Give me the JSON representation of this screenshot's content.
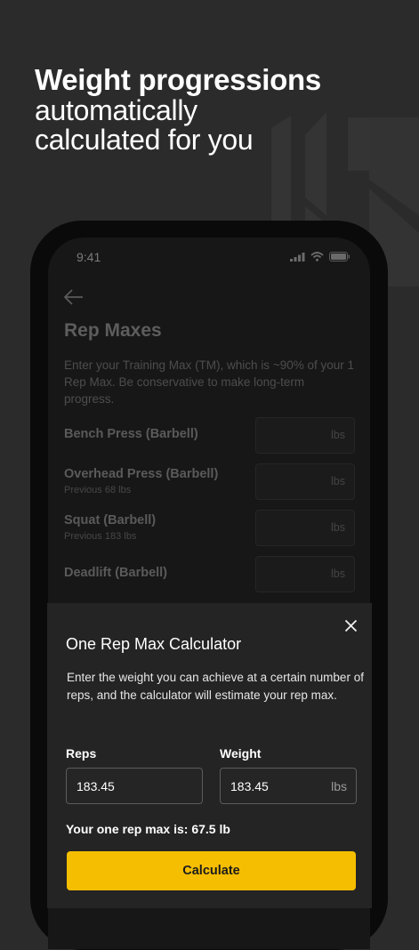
{
  "headline": {
    "bold": "Weight progressions",
    "line2": "automatically",
    "line3": "calculated for you"
  },
  "status_bar": {
    "time": "9:41",
    "icons": [
      "signal-icon",
      "wifi-icon",
      "battery-icon"
    ]
  },
  "screen": {
    "title": "Rep Maxes",
    "description": "Enter your Training Max (TM), which is ~90% of your 1 Rep Max. Be conservative to make long-term progress.",
    "exercises": [
      {
        "name": "Bench Press (Barbell)",
        "previous": "",
        "unit": "lbs"
      },
      {
        "name": "Overhead Press (Barbell)",
        "previous": "Previous 68 lbs",
        "unit": "lbs"
      },
      {
        "name": "Squat (Barbell)",
        "previous": "Previous 183 lbs",
        "unit": "lbs"
      },
      {
        "name": "Deadlift (Barbell)",
        "previous": "",
        "unit": "lbs"
      }
    ]
  },
  "calculator": {
    "title": "One Rep Max Calculator",
    "description": "Enter the weight you can achieve at a certain number of reps, and the calculator will estimate your rep max.",
    "reps_label": "Reps",
    "reps_value": "183.45",
    "weight_label": "Weight",
    "weight_value": "183.45",
    "weight_unit": "lbs",
    "result": "Your one rep max is: 67.5 lb",
    "button_label": "Calculate"
  },
  "colors": {
    "accent": "#f6be00",
    "background": "#2b2b2b"
  }
}
